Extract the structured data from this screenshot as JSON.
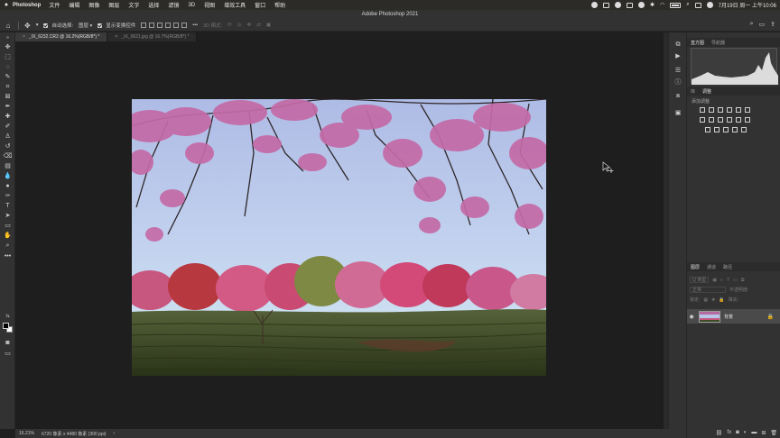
{
  "menubar": {
    "app_name": "Photoshop",
    "items": [
      "文件",
      "编辑",
      "图像",
      "图层",
      "文字",
      "选择",
      "滤镜",
      "3D",
      "视图",
      "增效工具",
      "窗口",
      "帮助"
    ],
    "clock": "7月19日 周一 上午10:06"
  },
  "window": {
    "title": "Adobe Photoshop 2021"
  },
  "options": {
    "auto_select_label": "自动选择:",
    "auto_select_value": "图层",
    "show_transform_label": "显示变换控件",
    "mode_3d_label": "3D 模式:",
    "more_label": "•••"
  },
  "tabs": [
    {
      "label": "_IX_6232.CR2 @ 16.2%(RGB/8*) *",
      "close": "×"
    },
    {
      "label": "_IX_0621.jpg @ 16.7%(RGB/8*) *",
      "close": "×"
    }
  ],
  "panels": {
    "top_tabs": [
      "直方图",
      "导航器"
    ],
    "mid_tabs": [
      "库",
      "调整"
    ],
    "add_adjustment_label": "添加调整",
    "layer_tabs": [
      "图层",
      "通道",
      "路径"
    ],
    "kind_label": "Q 类型",
    "blend_mode": "正常",
    "opacity_label": "不透明度:",
    "lock_label": "锁定:",
    "fill_label": "填充:",
    "layer_name": "背景"
  },
  "status": {
    "zoom": "16.21%",
    "doc_info": "6720 像素 x 4480 像素 (300 ppi)",
    "arrow": "›"
  },
  "colors": {
    "sky_top": "#b9c4e6",
    "sky_bottom": "#c7e0f0",
    "blossom": "#c46aa6",
    "tea_field": "#3e4a26"
  }
}
